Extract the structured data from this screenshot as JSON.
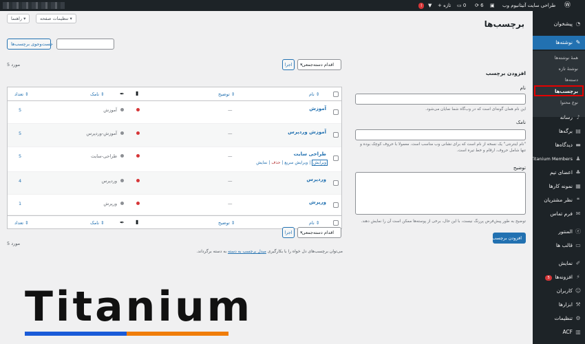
{
  "adminbar": {
    "site_name": "طراحی سایت آتیتانیوم وب",
    "updates_count": "6",
    "comments_count": "0",
    "new_label": "تازه",
    "notif_badge": "!"
  },
  "sidebar": {
    "items": [
      {
        "label": "پیشخوان"
      },
      {
        "label": "نوشته‌ها"
      },
      {
        "label": "رسانه"
      },
      {
        "label": "برگه‌ها"
      },
      {
        "label": "دیدگاه‌ها"
      },
      {
        "label": "Titanium Members"
      },
      {
        "label": "اعضای تیم"
      },
      {
        "label": "نمونه کارها"
      },
      {
        "label": "نظر مشتریان"
      },
      {
        "label": "فرم تماس"
      },
      {
        "label": "المنتور"
      },
      {
        "label": "قالب ها"
      },
      {
        "label": "نمایش"
      },
      {
        "label": "افزونه‌ها",
        "badge": "5"
      },
      {
        "label": "کاربران"
      },
      {
        "label": "ابزارها"
      },
      {
        "label": "تنظیمات"
      },
      {
        "label": "ACF"
      }
    ],
    "submenu": [
      "همهٔ نوشته‌ها",
      "نوشتهٔ تازه",
      "دسته‌ها",
      "برچسب‌ها",
      "نوع محتوا"
    ]
  },
  "header": {
    "screen_options": "تنظیمات صفحه",
    "help": "راهنما",
    "title": "برچسب‌ها"
  },
  "search": {
    "button": "جست‌وجوی برچسب‌ها",
    "value": ""
  },
  "add_form": {
    "title": "افزودن برچسب",
    "name_label": "نام",
    "name_help": "این نام همان گونه‌ای است که در وب‌گاه شما نمایان می‌شود.",
    "slug_label": "نامک",
    "slug_help": "\"نام اینترنتی\" یک نسخه از نام است که برای نشانی وب مناسب است. معمولا با حروف کوچک بوده و تنها شامل حروف، ارقام و خط تیره است.",
    "desc_label": "توضیح",
    "desc_help": "توضیح به طور پیش‌فرض پررنگ نیست، با این حال، برخی از پوسته‌ها ممکن است آن را نمایش دهند.",
    "submit": "افزودن برچسب"
  },
  "tablenav": {
    "bulk_label": "اقدام دسته‌جمعی",
    "apply": "اجرا",
    "count": "5 مورد"
  },
  "table": {
    "headers": {
      "name": "نام",
      "description": "توضیح",
      "slug": "نامک",
      "count": "تعداد"
    },
    "rows": [
      {
        "name": "آموزش",
        "description": "—",
        "slug": "آموزش",
        "count": "5"
      },
      {
        "name": "آموزش وردپرس",
        "description": "—",
        "slug": "آموزش-وردپرس",
        "count": "5"
      },
      {
        "name": "طراحی سایت",
        "description": "—",
        "slug": "طراحی-سایت",
        "count": "5",
        "actions": {
          "edit": "ویرایش",
          "quick": "ویرایش سریع",
          "delete": "حذف",
          "view": "نمایش"
        }
      },
      {
        "name": "وردپرس",
        "description": "—",
        "slug": "وردپرس",
        "count": "4"
      },
      {
        "name": "ورپرش",
        "description": "—",
        "slug": "ورپرش",
        "count": "1"
      }
    ]
  },
  "footer_note": {
    "before": "می‌توان برچسب‌های دل خواه را با بکارگیری ",
    "link": "مبدل برچسب به دسته",
    "after": " به دسته برگرداند."
  },
  "logo": {
    "text": "Titanium",
    "colors": {
      "text": "#111111",
      "blue": "#1a5bd8",
      "orange": "#f07d0a"
    }
  },
  "colors": {
    "accent": "#2271b1",
    "sidebar": "#1d2327",
    "highlight": "#e60000"
  }
}
